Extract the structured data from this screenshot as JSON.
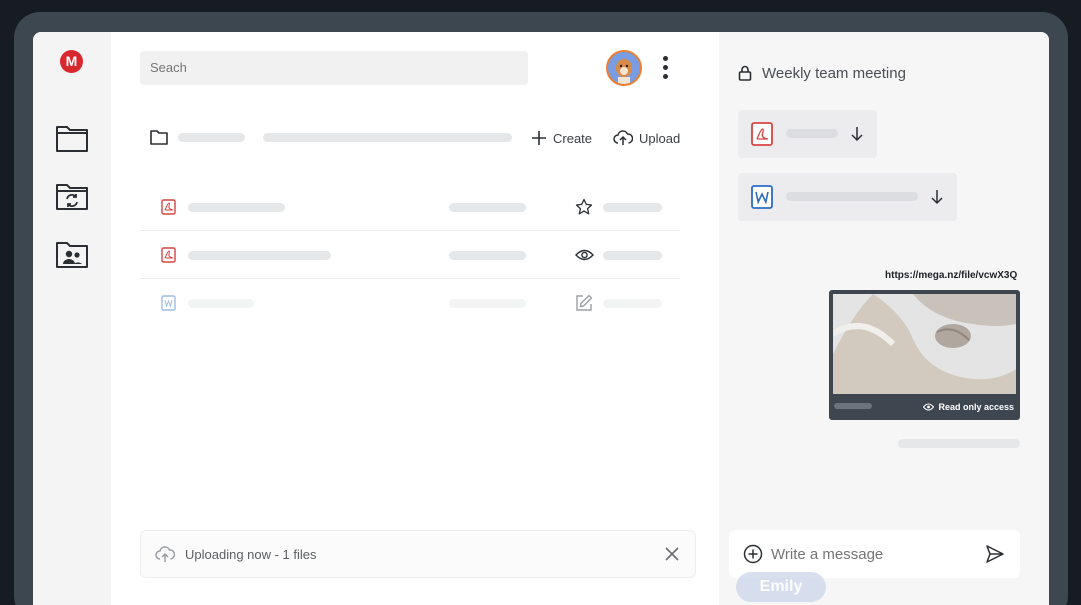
{
  "sidebar": {
    "logo_letter": "M",
    "items": [
      {
        "icon": "folder-icon"
      },
      {
        "icon": "folder-sync-icon"
      },
      {
        "icon": "folder-users-icon"
      }
    ]
  },
  "header": {
    "search_placeholder": "Seach"
  },
  "toolbar": {
    "create_label": "Create",
    "upload_label": "Upload"
  },
  "file_rows": [
    {
      "type": "pdf",
      "action_icon": "star-icon"
    },
    {
      "type": "pdf",
      "action_icon": "eye-icon"
    },
    {
      "type": "word",
      "action_icon": "edit-icon"
    }
  ],
  "upload_status": {
    "text": "Uploading now - 1 files"
  },
  "chat": {
    "title": "Weekly team meeting",
    "attachments": [
      {
        "type": "pdf"
      },
      {
        "type": "word"
      }
    ],
    "shared_link": "https://mega.nz/file/vcwX3Q",
    "preview_badge": "Read only access",
    "composer_placeholder": "Write a message",
    "participant_bubble": "Emily"
  },
  "colors": {
    "brand_red": "#d9272e",
    "word_blue": "#2b6cc4",
    "pdf_red": "#d64541"
  }
}
